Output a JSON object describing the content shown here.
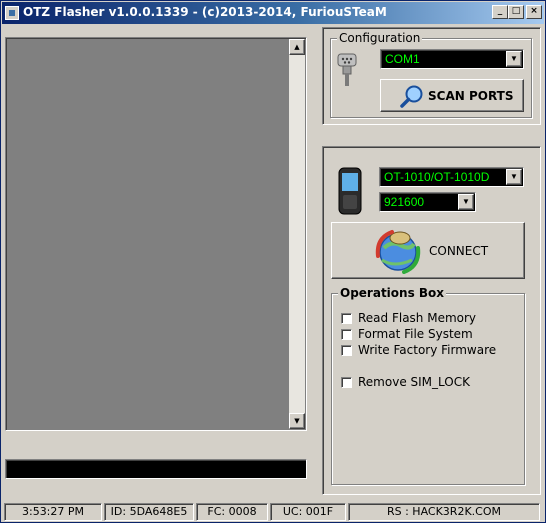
{
  "window": {
    "title": "OTZ Flasher v1.0.0.1339 - (c)2013-2014, FuriouSTeaM",
    "minimize_glyph": "_",
    "maximize_glyph": "□",
    "close_glyph": "×"
  },
  "log": {
    "scroll_up_glyph": "▲",
    "scroll_down_glyph": "▼"
  },
  "configuration": {
    "group_label": "Configuration",
    "port_icon": "serial-port-icon",
    "port_value": "COM1",
    "scan_button_label": "SCAN PORTS",
    "scan_icon": "magnifier-icon"
  },
  "device": {
    "phone_icon": "phone-icon",
    "model_value": "OT-1010/OT-1010D",
    "baud_value": "921600",
    "connect_button_label": "CONNECT",
    "connect_icon": "connect-globe-icon"
  },
  "operations": {
    "group_label": "Operations Box",
    "items": [
      {
        "label": "Read Flash Memory",
        "checked": false
      },
      {
        "label": "Format File System",
        "checked": false
      },
      {
        "label": "Write Factory Firmware",
        "checked": false
      },
      {
        "label": "Remove SIM_LOCK",
        "checked": false
      }
    ]
  },
  "status_bar": {
    "time": "3:53:27 PM",
    "id": "ID: 5DA648E5",
    "fc": "FC: 0008",
    "uc": "UC: 001F",
    "rs": "RS : HACK3R2K.COM"
  },
  "colors": {
    "combo_text": "#00ff00",
    "combo_bg": "#000000",
    "log_bg": "#808080",
    "window_bg": "#d4d0c8"
  }
}
